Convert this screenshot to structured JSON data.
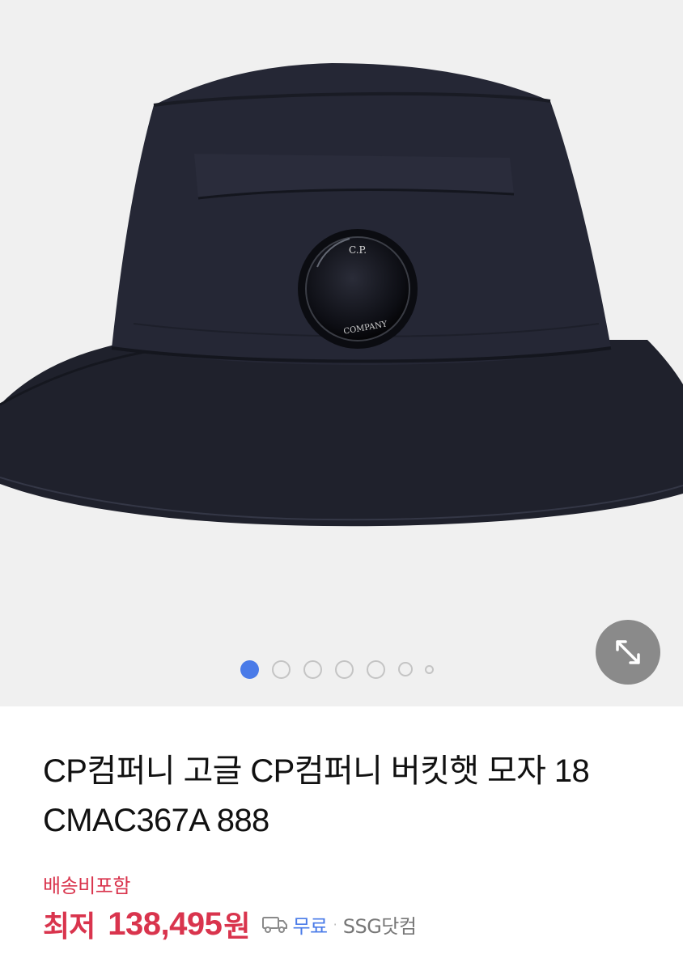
{
  "gallery": {
    "image_alt": "CP컴퍼니 버킷햇",
    "lens_text_top": "C.P.",
    "lens_text_bottom": "COMPANY",
    "current_page": 1,
    "page_count": 7,
    "expand_icon": "expand-icon"
  },
  "product": {
    "title": "CP컴퍼니 고글 CP컴퍼니 버킷햇 모자 18 CMAC367A 888",
    "shipping_note": "배송비포함",
    "price_label": "최저",
    "price": "138,495",
    "price_unit": "원",
    "delivery_icon": "truck-icon",
    "delivery": "무료",
    "separator": "·",
    "seller": "SSG닷컴"
  },
  "colors": {
    "price": "#d9344d",
    "accent": "#4a7be8",
    "gallery_bg": "#f0f0f0",
    "hat": "#20222e"
  }
}
